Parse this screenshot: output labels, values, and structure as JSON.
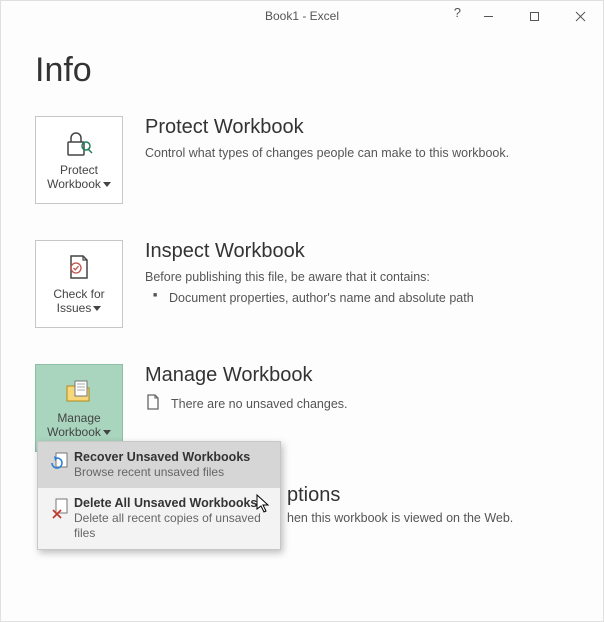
{
  "window": {
    "title": "Book1  -  Excel"
  },
  "page": {
    "title": "Info"
  },
  "sections": {
    "protect": {
      "tile_label_line1": "Protect",
      "tile_label_line2": "Workbook",
      "heading": "Protect Workbook",
      "desc": "Control what types of changes people can make to this workbook."
    },
    "inspect": {
      "tile_label_line1": "Check for",
      "tile_label_line2": "Issues",
      "heading": "Inspect Workbook",
      "desc": "Before publishing this file, be aware that it contains:",
      "bullet1": "Document properties, author's name and absolute path"
    },
    "manage": {
      "tile_label_line1": "Manage",
      "tile_label_line2": "Workbook",
      "heading": "Manage Workbook",
      "status": "There are no unsaved changes."
    },
    "browser": {
      "heading_fragment": "ptions",
      "desc_fragment": "hen this workbook is viewed on the Web."
    }
  },
  "menu": {
    "items": [
      {
        "title": "Recover Unsaved Workbooks",
        "desc": "Browse recent unsaved files"
      },
      {
        "title": "Delete All Unsaved Workbooks",
        "desc": "Delete all recent copies of unsaved files"
      }
    ]
  }
}
